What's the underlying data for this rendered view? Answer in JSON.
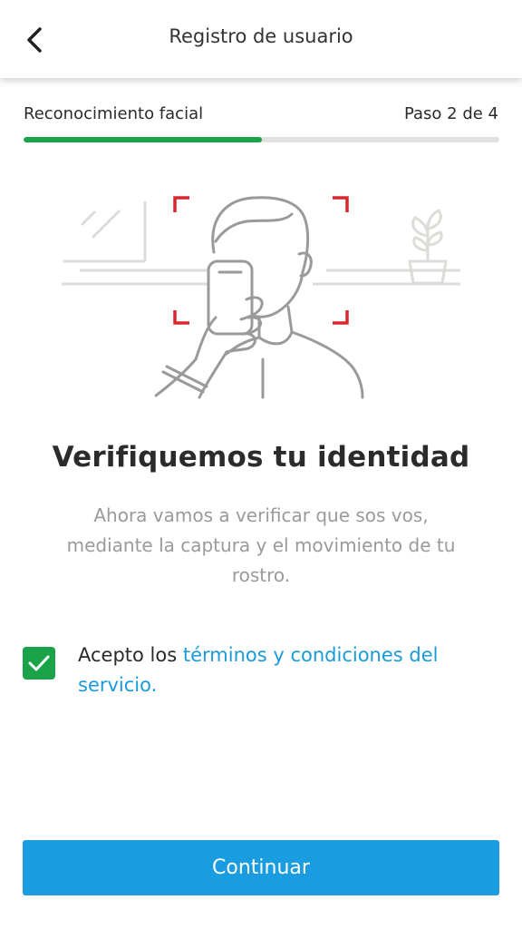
{
  "header": {
    "title": "Registro de usuario"
  },
  "steps": {
    "label": "Reconocimiento facial",
    "counter": "Paso 2 de 4",
    "progress_percent": 50,
    "progress_color": "#1ba34a"
  },
  "content": {
    "title": "Verifiquemos tu identidad",
    "description": "Ahora vamos a verificar que sos vos, mediante la captura y el movimiento de tu rostro."
  },
  "terms": {
    "checked": true,
    "prefix": "Acepto los ",
    "link": "términos y condiciones del servicio."
  },
  "actions": {
    "continue_label": "Continuar",
    "continue_color": "#1a9de0"
  },
  "icons": {
    "back": "chevron-left-icon",
    "check": "check-icon"
  }
}
